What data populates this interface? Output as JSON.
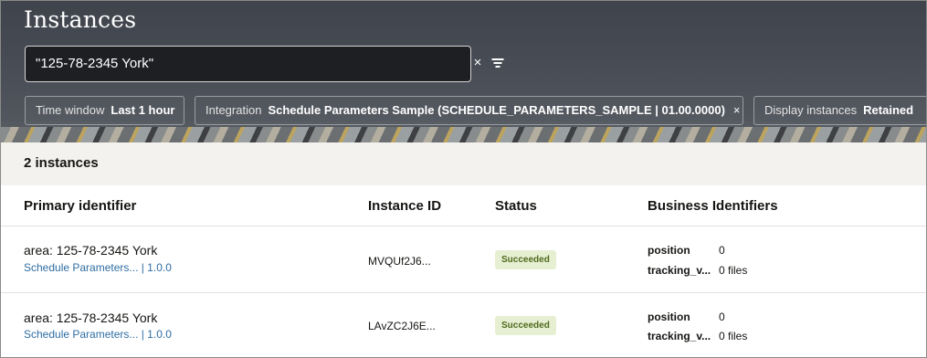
{
  "page": {
    "title": "Instances"
  },
  "search": {
    "value": "\"125-78-2345 York\""
  },
  "filters": {
    "time_window": {
      "label": "Time window",
      "value": "Last 1 hour"
    },
    "integration": {
      "label": "Integration",
      "value": "Schedule Parameters Sample (SCHEDULE_PARAMETERS_SAMPLE | 01.00.0000)"
    },
    "display_instances": {
      "label": "Display instances",
      "value": "Retained"
    }
  },
  "icons": {
    "clear": "×",
    "chip_remove": "×"
  },
  "results": {
    "count_text": "2 instances"
  },
  "table": {
    "columns": [
      "Primary identifier",
      "Instance ID",
      "Status",
      "Business Identifiers"
    ],
    "rows": [
      {
        "primary": "area: 125-78-2345 York",
        "link": "Schedule Parameters... | 1.0.0",
        "instance_id": "MVQUf2J6...",
        "status": "Succeeded",
        "biz": [
          {
            "key": "position",
            "value": "0"
          },
          {
            "key": "tracking_v...",
            "value": "0 files"
          }
        ]
      },
      {
        "primary": "area: 125-78-2345 York",
        "link": "Schedule Parameters... | 1.0.0",
        "instance_id": "LAvZC2J6E...",
        "status": "Succeeded",
        "biz": [
          {
            "key": "position",
            "value": "0"
          },
          {
            "key": "tracking_v...",
            "value": "0 files"
          }
        ]
      }
    ]
  },
  "colors": {
    "header_bg": "#4a4f57",
    "link": "#2f6da4",
    "success_bg": "#e7efd3",
    "success_fg": "#4f6a1c"
  }
}
